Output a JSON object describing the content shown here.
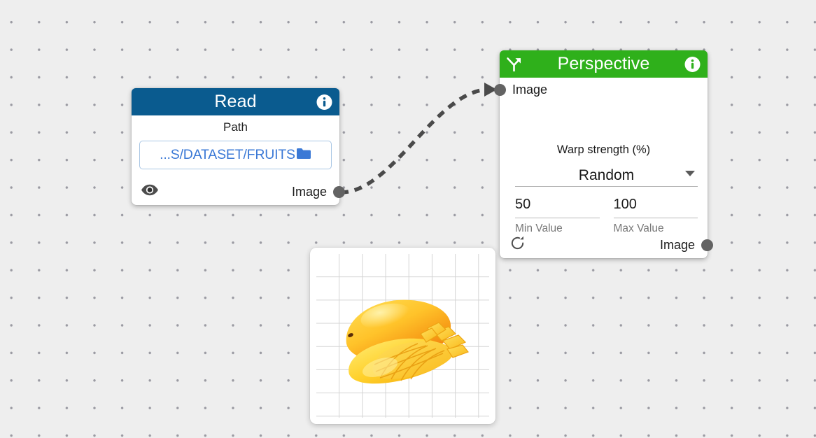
{
  "canvas": {
    "background_color": "#eeeeee",
    "dot_color": "#9a9aa2"
  },
  "nodes": [
    {
      "id": "read",
      "title": "Read",
      "header_color": "#0a5b8f",
      "info_icon": "info-icon",
      "param_label": "Path",
      "path_value": "...S/DATASET/FRUITS",
      "path_text_color": "#3b79d6",
      "folder_icon": "folder-icon",
      "visibility_icon": "eye-icon",
      "output_label": "Image"
    },
    {
      "id": "perspective",
      "title": "Perspective",
      "header_color": "#2fb01b",
      "branch_icon": "branch-arrow-icon",
      "info_icon": "info-icon",
      "input_label": "Image",
      "param_label": "Warp strength (%)",
      "mode_value": "Random",
      "min_value": "50",
      "max_value": "100",
      "min_caption": "Min Value",
      "max_caption": "Max Value",
      "refresh_icon": "refresh-icon",
      "output_label": "Image"
    }
  ],
  "connection": {
    "from": "read.output.Image",
    "to": "perspective.input.Image",
    "style": "dashed",
    "color": "#4a4a4a"
  },
  "preview": {
    "title": "image-preview",
    "content": "mango",
    "grid_color": "#d4d4d4"
  }
}
